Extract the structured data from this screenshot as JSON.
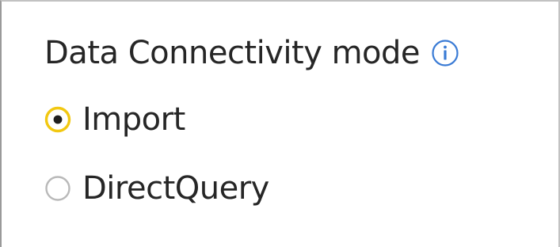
{
  "section": {
    "title": "Data Connectivity mode",
    "info_icon": "info-icon"
  },
  "options": [
    {
      "label": "Import",
      "selected": true
    },
    {
      "label": "DirectQuery",
      "selected": false
    }
  ],
  "colors": {
    "accent": "#f2c811",
    "info_blue": "#3a7bd5",
    "radio_border_unselected": "#b9b9b9",
    "radio_dot": "#1f1f1f",
    "text": "#262626"
  }
}
